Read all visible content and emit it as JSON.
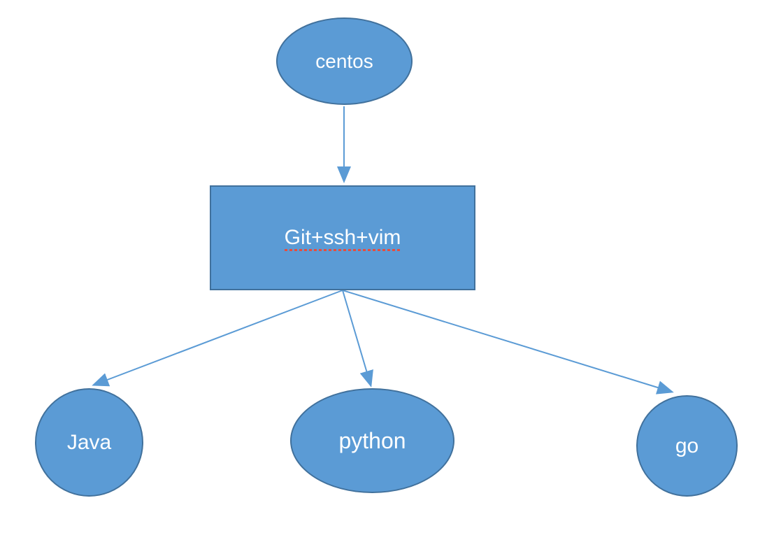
{
  "nodes": {
    "centos": "centos",
    "middle": "Git+ssh+vim",
    "java": "Java",
    "python": "python",
    "go": "go"
  },
  "colors": {
    "fill": "#5b9bd5",
    "stroke": "#41719c",
    "text": "#ffffff"
  }
}
